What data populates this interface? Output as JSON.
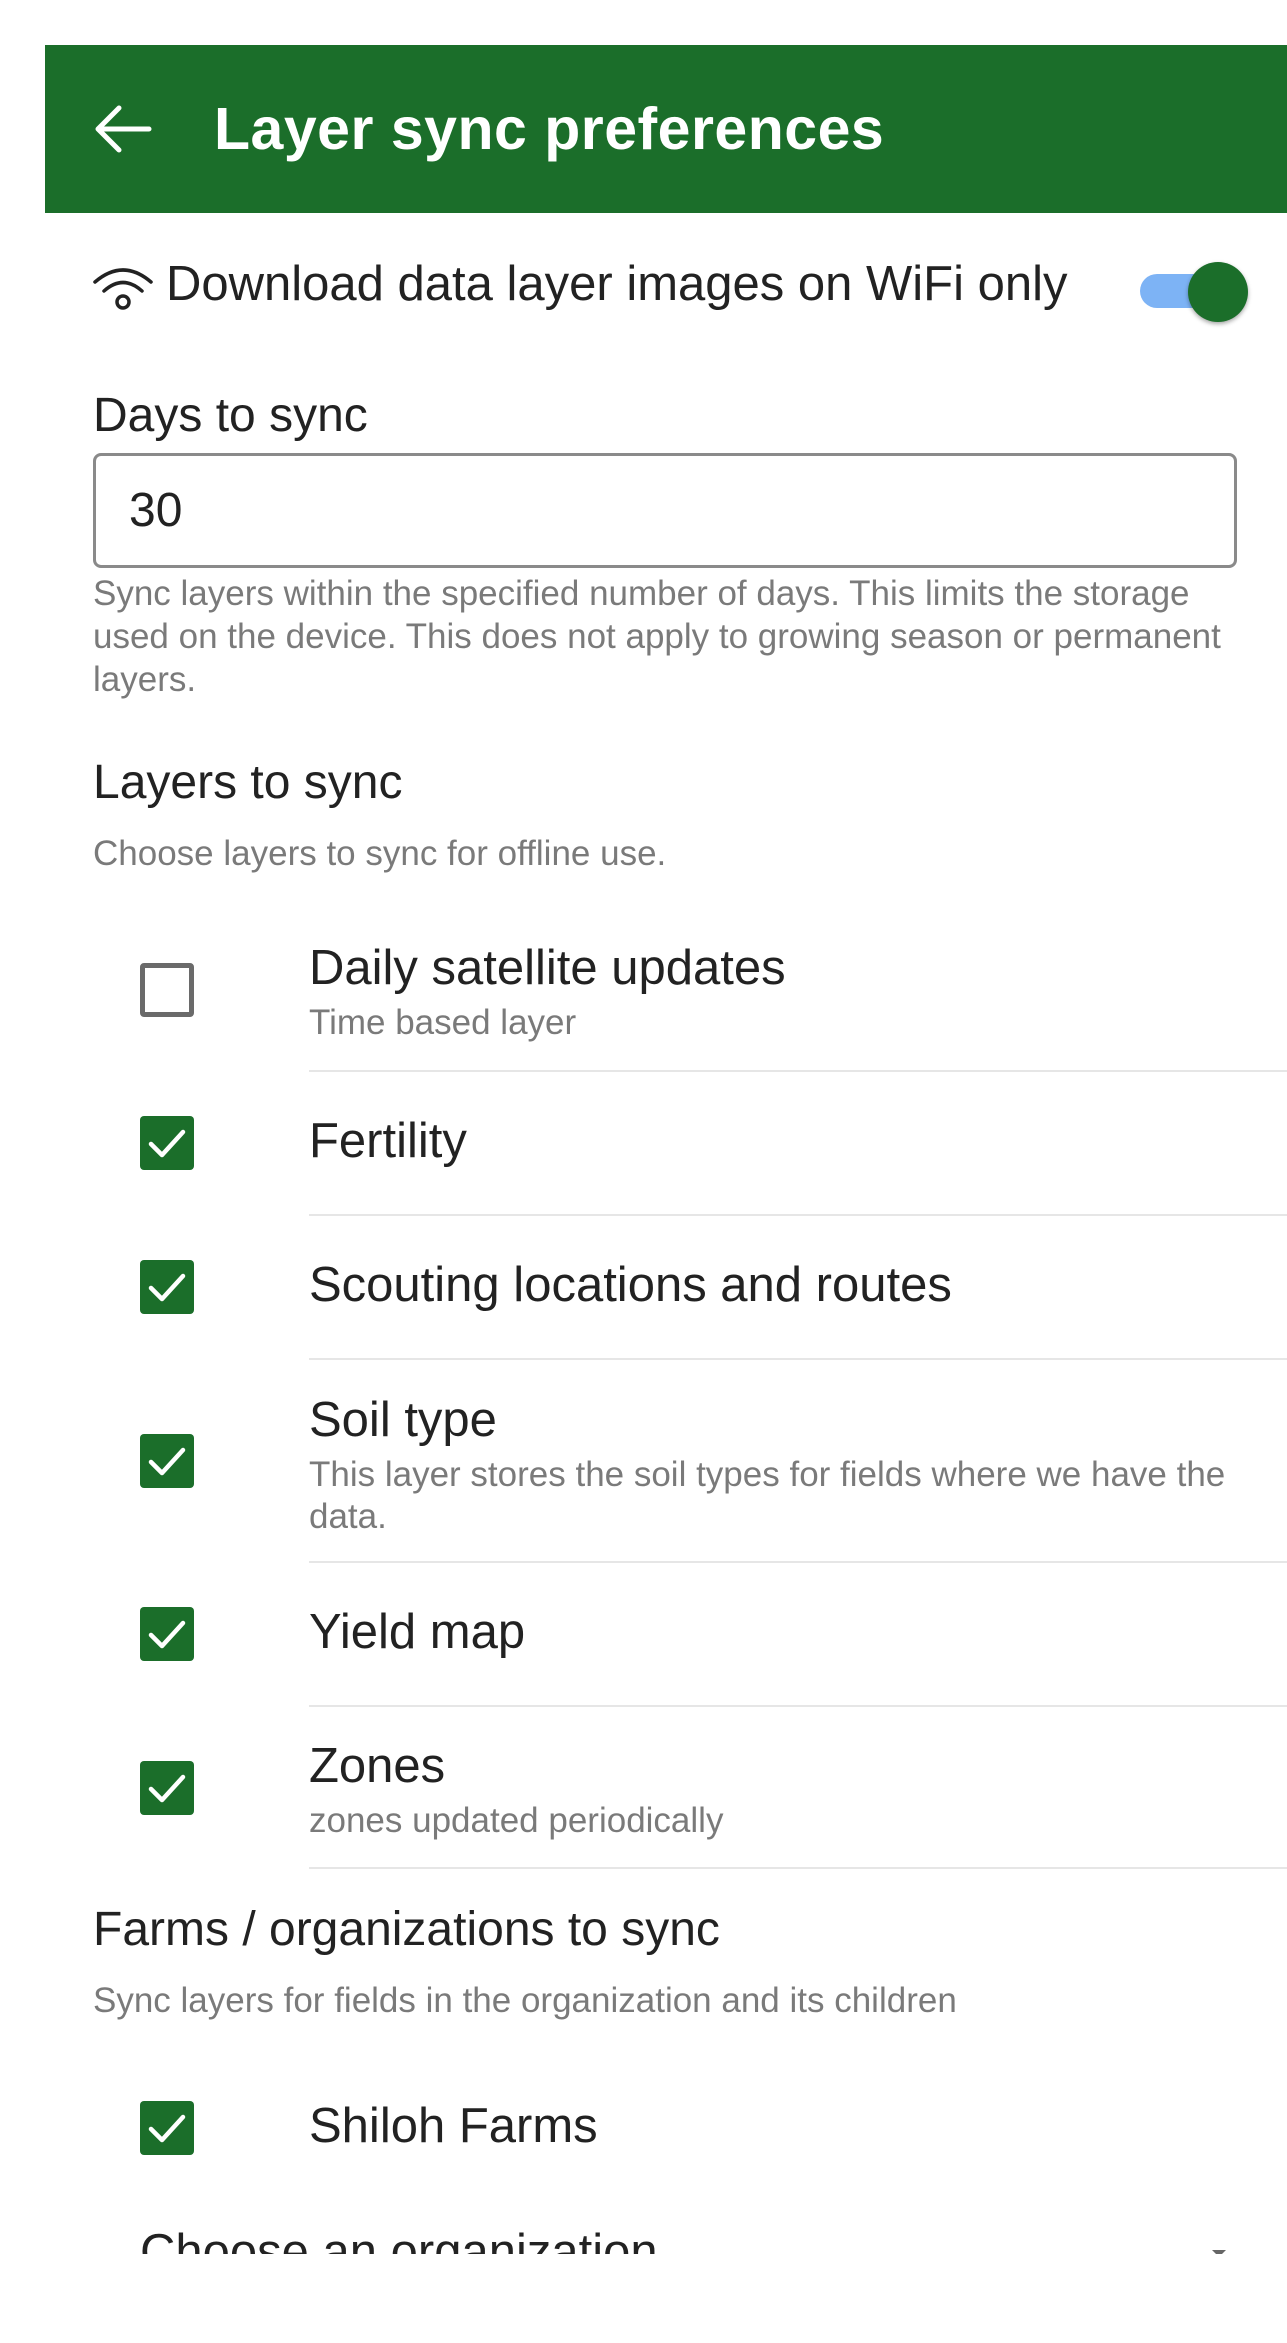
{
  "appbar": {
    "title": "Layer sync preferences",
    "back_icon": "arrow-left-icon",
    "background_color": "#1b6e2a"
  },
  "wifi_setting": {
    "icon": "wifi-icon",
    "label": "Download data layer images on WiFi only",
    "enabled": true,
    "track_color": "#7db3f5",
    "thumb_color": "#1b6e2a"
  },
  "days_to_sync": {
    "label": "Days to sync",
    "value": "30",
    "helper": "Sync layers within the specified number of days. This limits the storage used on the device. This does not apply to growing season or permanent layers."
  },
  "layers_to_sync": {
    "heading": "Layers to sync",
    "helper": "Choose layers to sync for offline use.",
    "items": [
      {
        "title": "Daily satellite updates",
        "subtitle": "Time based layer",
        "checked": false
      },
      {
        "title": "Fertility",
        "subtitle": "",
        "checked": true
      },
      {
        "title": "Scouting locations and routes",
        "subtitle": "",
        "checked": true
      },
      {
        "title": "Soil type",
        "subtitle": "This layer stores the soil types for fields where we have the data.",
        "checked": true
      },
      {
        "title": "Yield map",
        "subtitle": "",
        "checked": true
      },
      {
        "title": "Zones",
        "subtitle": "zones updated periodically",
        "checked": true
      }
    ]
  },
  "farms_to_sync": {
    "heading": "Farms / organizations to sync",
    "helper": "Sync layers for fields in the organization and its children",
    "items": [
      {
        "title": "Shiloh Farms",
        "checked": true
      }
    ],
    "chooser_label": "Choose an organization"
  },
  "colors": {
    "accent": "#1b6e2a",
    "helper_text": "#7a7a7a"
  }
}
